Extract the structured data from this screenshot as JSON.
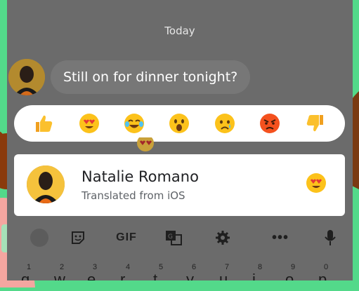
{
  "chat": {
    "date_label": "Today",
    "message": {
      "text": "Still on for dinner tonight?"
    }
  },
  "reactions": [
    {
      "name": "thumbs-up",
      "glyph": "👍"
    },
    {
      "name": "heart-eyes",
      "glyph": "😍"
    },
    {
      "name": "laughing",
      "glyph": "😂"
    },
    {
      "name": "surprised",
      "glyph": "😮"
    },
    {
      "name": "crying",
      "glyph": "😢"
    },
    {
      "name": "angry",
      "glyph": "😡"
    },
    {
      "name": "thumbs-down",
      "glyph": "👎"
    }
  ],
  "reaction_card": {
    "name": "Natalie Romano",
    "subtitle": "Translated from iOS",
    "reaction": "heart-eyes"
  },
  "keyboard": {
    "toolbar": [
      "sticker-icon",
      "gif",
      "translate-icon",
      "gear-icon",
      "more-icon",
      "mic-icon"
    ],
    "gif_label": "GIF",
    "more_label": "•••",
    "number_row": [
      "1",
      "2",
      "3",
      "4",
      "5",
      "6",
      "7",
      "8",
      "9",
      "0"
    ],
    "letter_row": [
      "q",
      "w",
      "e",
      "r",
      "t",
      "y",
      "u",
      "i",
      "o",
      "p"
    ]
  },
  "colors": {
    "background": "#53d98a",
    "dim_overlay": "#6b6b6b",
    "bubble": "#777777",
    "panel": "#ffffff"
  }
}
